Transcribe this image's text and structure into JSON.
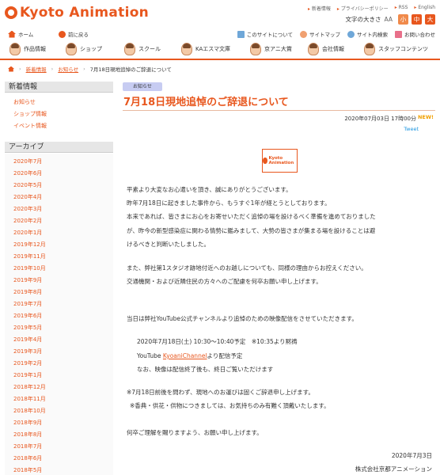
{
  "header": {
    "logo_text": "Kyoto Animation",
    "util_links": [
      "新着情報",
      "プライバシーポリシー",
      "RSS",
      "English"
    ],
    "font_size_label": "文字の大きさ",
    "font_size_aa": "AA",
    "font_sizes": [
      "小",
      "中",
      "大"
    ],
    "font_size_colors": [
      "#f08a4b",
      "#e8571e",
      "#e8571e"
    ]
  },
  "sub_nav": {
    "home": "ホーム",
    "back": "前に戻る",
    "right": [
      "このサイトについて",
      "サイトマップ",
      "サイト内検索",
      "お問い合わせ"
    ]
  },
  "main_nav": [
    "作品情報",
    "ショップ",
    "スクール",
    "KAエスマ文庫",
    "京アニ大賞",
    "会社情報",
    "スタッフコンテンツ"
  ],
  "breadcrumb": [
    "新着情報",
    "お知らせ",
    "7月18日現地追悼のご辞退について"
  ],
  "sidebar": {
    "news_heading": "新着情報",
    "news_links": [
      "お知らせ",
      "ショップ情報",
      "イベント情報"
    ],
    "archive_heading": "アーカイブ",
    "archive_links": [
      "2020年7月",
      "2020年6月",
      "2020年5月",
      "2020年4月",
      "2020年3月",
      "2020年2月",
      "2020年1月",
      "2019年12月",
      "2019年11月",
      "2019年10月",
      "2019年9月",
      "2019年8月",
      "2019年7月",
      "2019年6月",
      "2019年5月",
      "2019年4月",
      "2019年3月",
      "2019年2月",
      "2019年1月",
      "2018年12月",
      "2018年11月",
      "2018年10月",
      "2018年9月",
      "2018年8月",
      "2018年7月",
      "2018年6月",
      "2018年5月"
    ]
  },
  "article": {
    "badge": "お知らせ",
    "title": "7月18日現地追悼のご辞退について",
    "date": "2020年07月03日 17時00分",
    "new_mark": "NEW!",
    "tweet": "Tweet",
    "logo_text": "Kyoto Animation",
    "paragraphs": [
      "平素より大変なお心遣いを頂き、誠にありがとうございます。",
      "昨年7月18日に起きました事件から、もうすぐ1年が経とうとしております。",
      "本来であれば、皆さまにお心をお寄せいただく追悼の場を設けるべく準備を進めておりました",
      "が、昨今の新型感染症に関わる情勢に鑑みまして、大勢の皆さまが集まる場を設けることは避",
      "けるべきと判断いたしました。",
      "また、弊社第1スタジオ跡地付近へのお越しについても、同様の理由からお控えください。",
      "交通機関・および近隣住民の方々へのご配慮を何卒お願い申し上げます。",
      "当日は弊社YouTube公式チャンネルより追悼のための映像配信をさせていただきます。",
      "2020年7月18日(土) 10:30〜10:40予定　※10:35より黙祷",
      "YouTube ",
      "KyoaniChannel",
      "より配信予定",
      "なお、映像は配信終了後も、終日ご覧いただけます",
      "※7月18日前後を問わず、現地へのお運びは固くご辞退申し上げます。",
      "※香典・供花・供物につきましては、お気持ちのみ有難く頂戴いたします。",
      "何卒ご理解を賜りますよう、お願い申し上げます。",
      "2020年7月3日",
      "株式会社京都アニメーション"
    ]
  }
}
